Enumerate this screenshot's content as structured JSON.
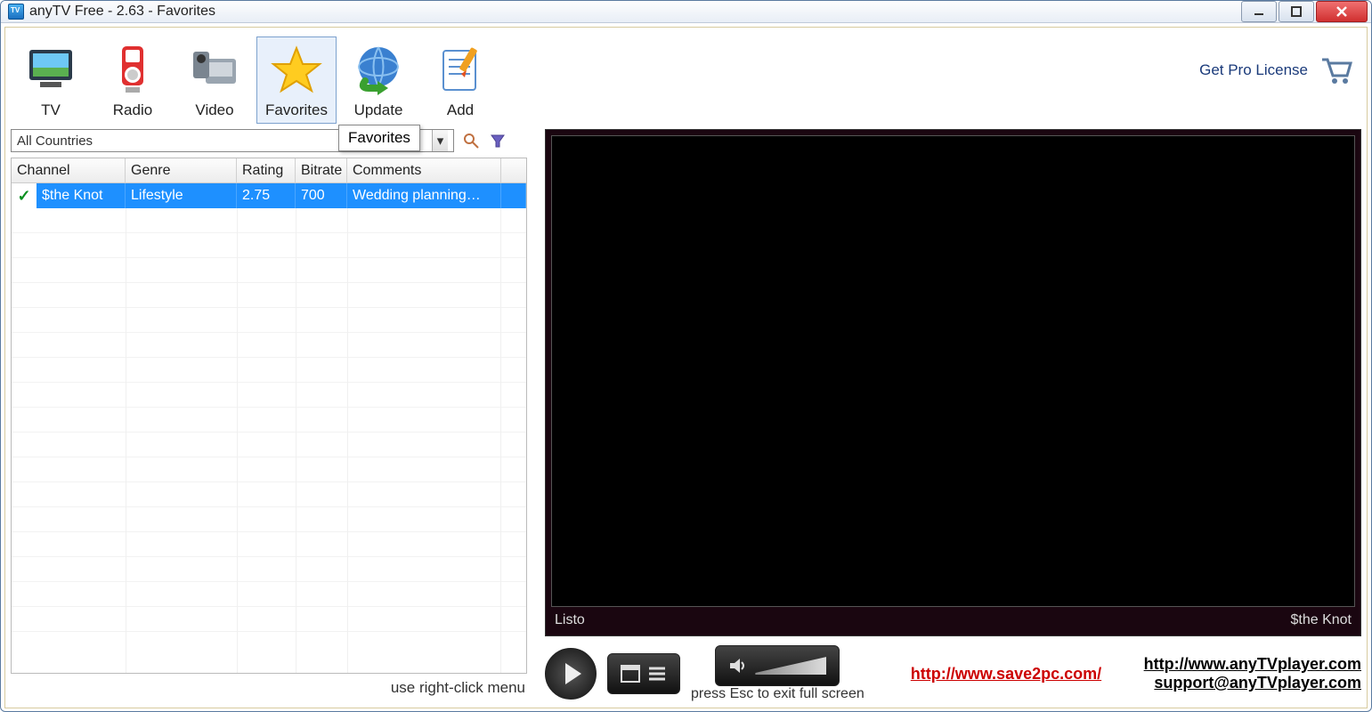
{
  "window": {
    "title": "anyTV Free - 2.63 - Favorites"
  },
  "toolbar": {
    "items": [
      {
        "label": "TV"
      },
      {
        "label": "Radio"
      },
      {
        "label": "Video"
      },
      {
        "label": "Favorites"
      },
      {
        "label": "Update"
      },
      {
        "label": "Add"
      }
    ],
    "tooltip": "Favorites"
  },
  "pro": {
    "link_label": "Get Pro License"
  },
  "filter": {
    "country_value": "All Countries"
  },
  "table": {
    "headers": {
      "channel": "Channel",
      "genre": "Genre",
      "rating": "Rating",
      "bitrate": "Bitrate",
      "comments": "Comments"
    },
    "rows": [
      {
        "channel": "$the Knot",
        "genre": "Lifestyle",
        "rating": "2.75",
        "bitrate": "700",
        "comments": "Wedding planning…"
      }
    ]
  },
  "left_hint": "use right-click menu",
  "player": {
    "status_left": "Listo",
    "status_right": "$the Knot",
    "esc_hint": "press Esc to exit full screen"
  },
  "links": {
    "promo": "http://www.save2pc.com/",
    "site": "http://www.anyTVplayer.com",
    "support": "support@anyTVplayer.com"
  }
}
